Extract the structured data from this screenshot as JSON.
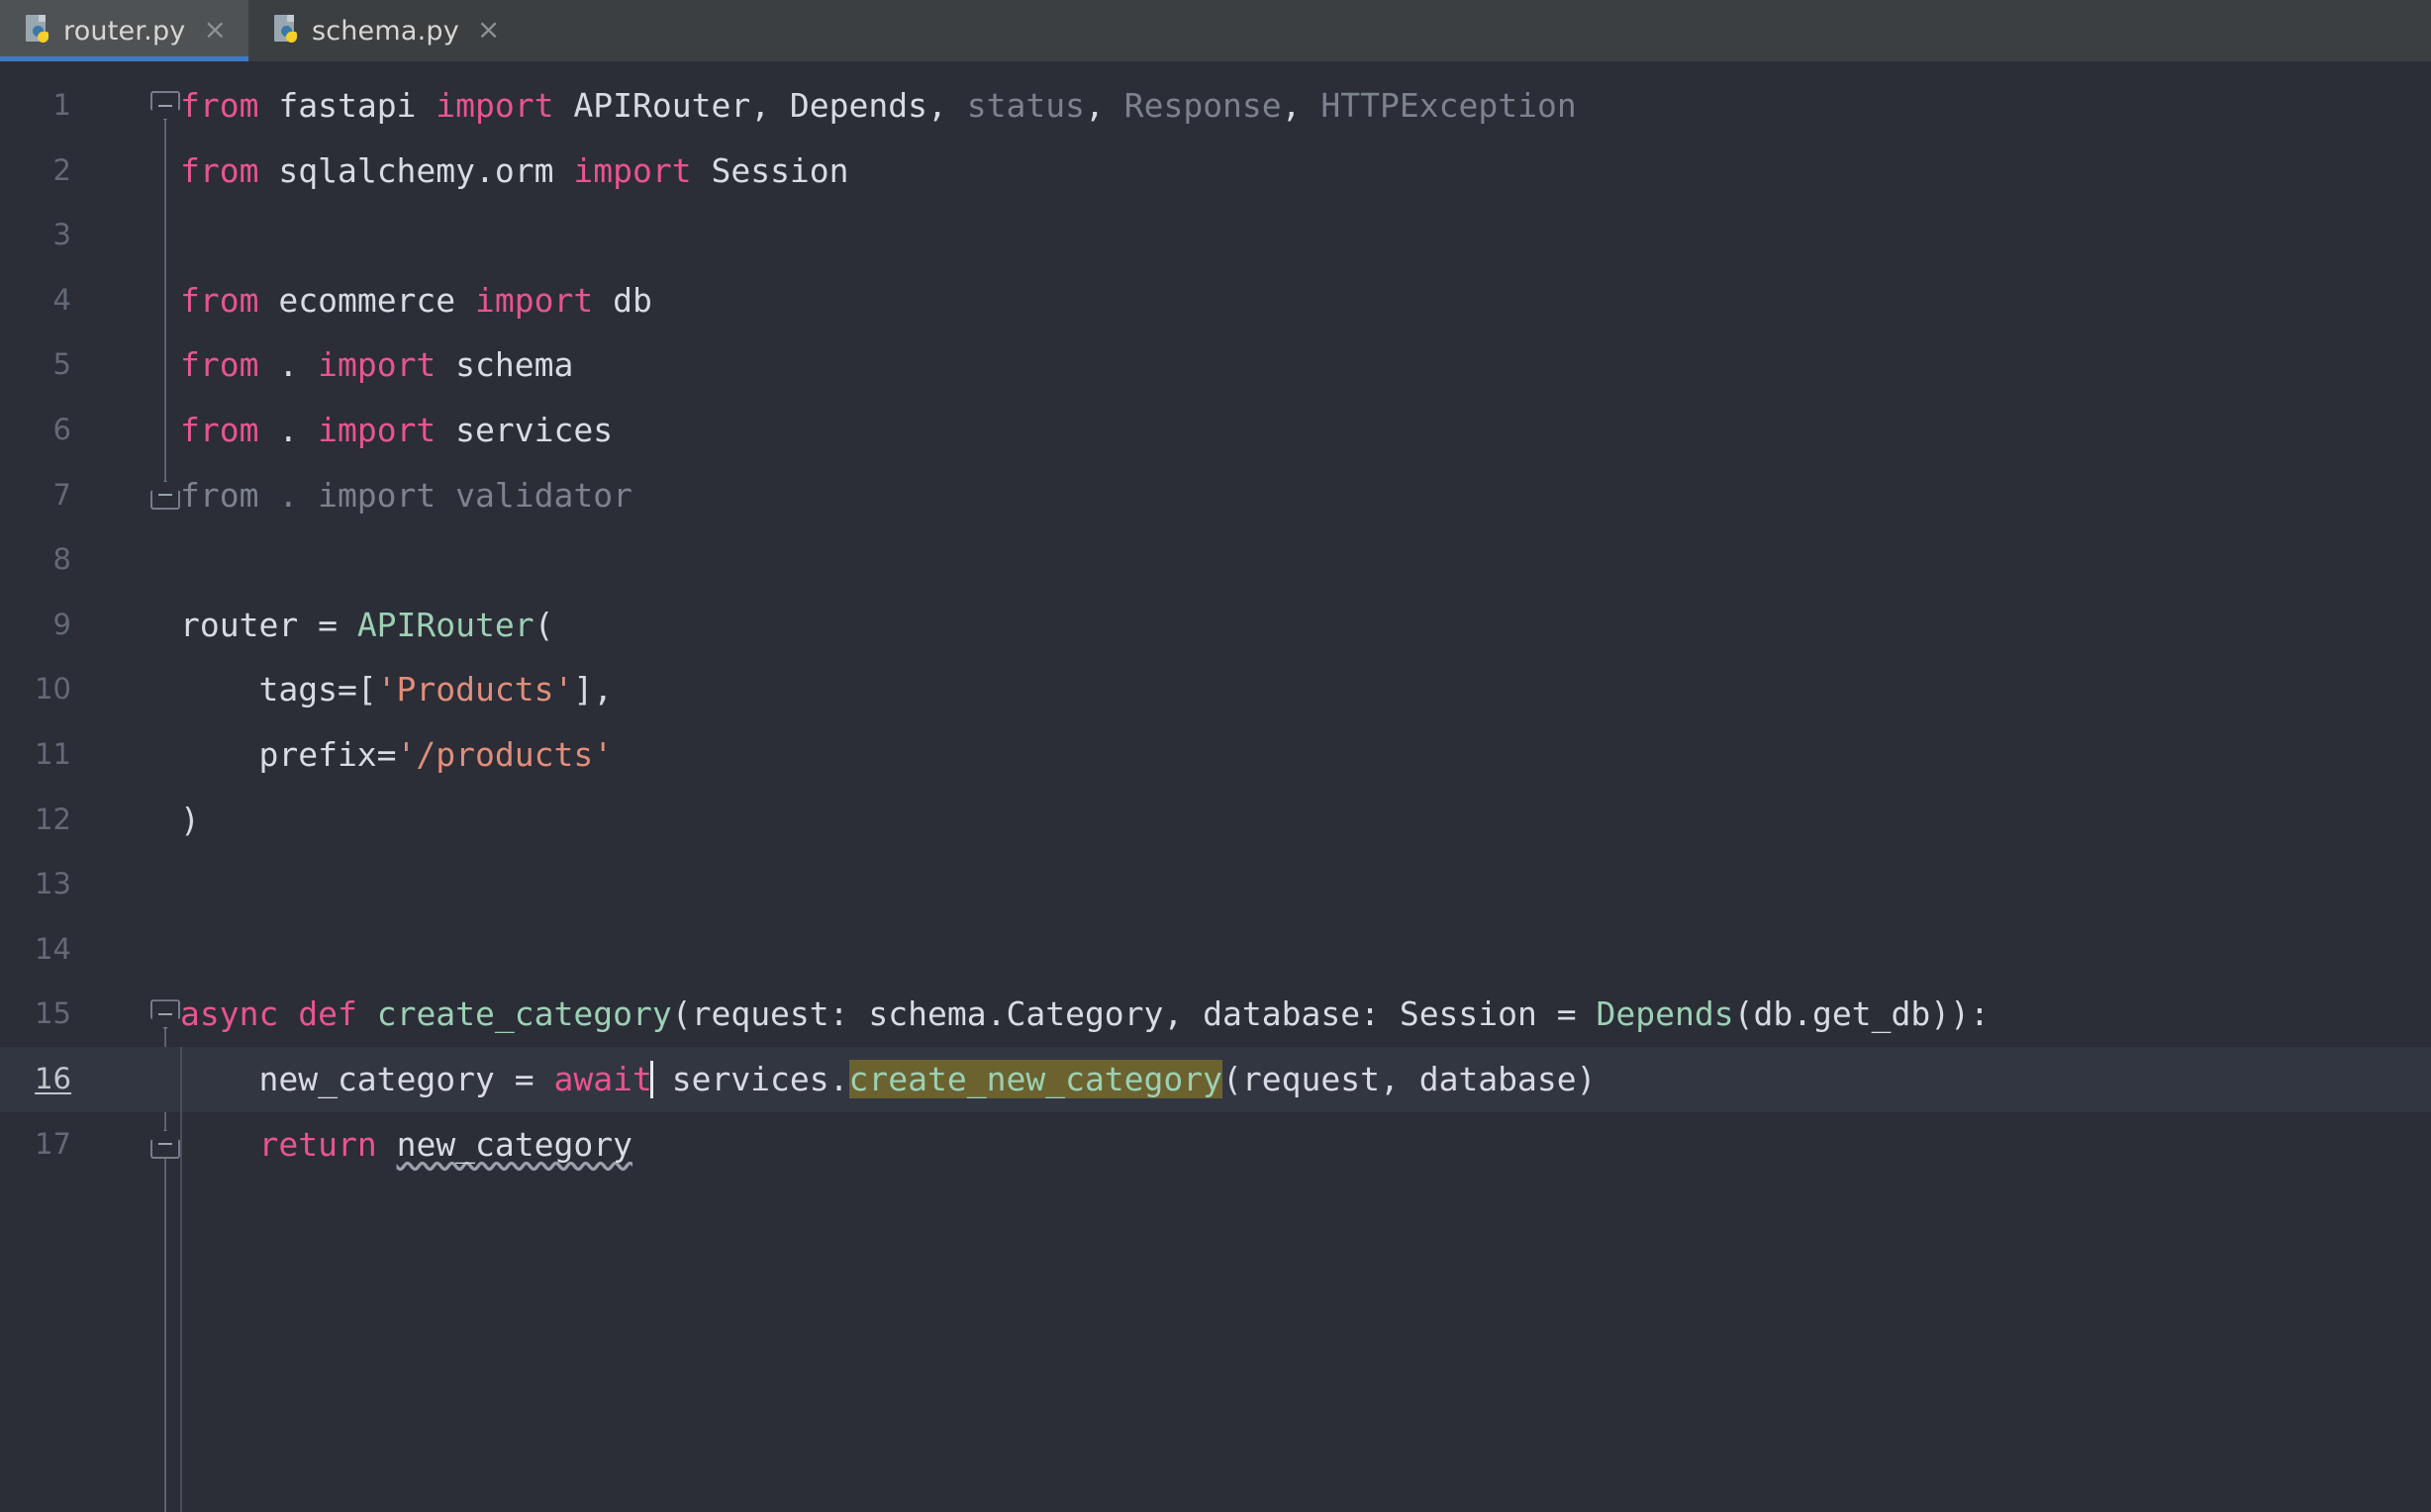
{
  "window": {
    "app": "pycharm-editor",
    "colors": {
      "editor_bg": "#2b2d37",
      "tabbar_bg": "#3c3f41",
      "active_tab_bg": "#4e5254",
      "active_tab_underline": "#3d7ac4",
      "current_line_bg": "#323641",
      "keyword": "#e8558e",
      "class_name": "#9cd0b4",
      "string": "#e08e79",
      "unused_grey": "#7c828e",
      "usage_highlight": "#6b6230",
      "line_number": "#636a75"
    }
  },
  "tabbar": {
    "tabs": [
      {
        "label": "router.py",
        "icon": "python-file-icon",
        "close_icon": "×",
        "active": true
      },
      {
        "label": "schema.py",
        "icon": "python-file-icon",
        "close_icon": "×",
        "active": false
      }
    ]
  },
  "editor": {
    "file": "router.py",
    "language": "python",
    "current_line": 16,
    "caret": {
      "line": 16,
      "after_token": "await"
    },
    "highlighted_symbol": "create_new_category",
    "warning_symbol": "new_category",
    "line_numbers": [
      "1",
      "2",
      "3",
      "4",
      "5",
      "6",
      "7",
      "8",
      "9",
      "10",
      "11",
      "12",
      "13",
      "14",
      "15",
      "16",
      "17"
    ],
    "lines": [
      {
        "n": "1",
        "text": "from fastapi import APIRouter, Depends, status, Response, HTTPException"
      },
      {
        "n": "2",
        "text": "from sqlalchemy.orm import Session"
      },
      {
        "n": "3",
        "text": ""
      },
      {
        "n": "4",
        "text": "from ecommerce import db"
      },
      {
        "n": "5",
        "text": "from . import schema"
      },
      {
        "n": "6",
        "text": "from . import services"
      },
      {
        "n": "7",
        "text": "from . import validator"
      },
      {
        "n": "8",
        "text": ""
      },
      {
        "n": "9",
        "text": "router = APIRouter("
      },
      {
        "n": "10",
        "text": "    tags=['Products'],"
      },
      {
        "n": "11",
        "text": "    prefix='/products'"
      },
      {
        "n": "12",
        "text": ")"
      },
      {
        "n": "13",
        "text": ""
      },
      {
        "n": "14",
        "text": ""
      },
      {
        "n": "15",
        "text": "async def create_category(request: schema.Category, database: Session = Depends(db.get_db)):"
      },
      {
        "n": "16",
        "text": "    new_category = await services.create_new_category(request, database)"
      },
      {
        "n": "17",
        "text": "    return new_category"
      }
    ],
    "tokens": {
      "l1": [
        [
          "from",
          "kw"
        ],
        [
          " fastapi ",
          "plain"
        ],
        [
          "import",
          "kw"
        ],
        [
          " APIRouter, Depends, ",
          "plain"
        ],
        [
          "status",
          "dim"
        ],
        [
          ", ",
          "plain"
        ],
        [
          "Response",
          "dim"
        ],
        [
          ", ",
          "plain"
        ],
        [
          "HTTPException",
          "dim"
        ]
      ],
      "l2": [
        [
          "from",
          "kw"
        ],
        [
          " sqlalchemy.orm ",
          "plain"
        ],
        [
          "import",
          "kw"
        ],
        [
          " Session",
          "plain"
        ]
      ],
      "l4": [
        [
          "from",
          "kw"
        ],
        [
          " ecommerce ",
          "plain"
        ],
        [
          "import",
          "kw"
        ],
        [
          " db",
          "plain"
        ]
      ],
      "l5": [
        [
          "from",
          "kw"
        ],
        [
          " . ",
          "plain"
        ],
        [
          "import",
          "kw"
        ],
        [
          " schema",
          "plain"
        ]
      ],
      "l6": [
        [
          "from",
          "kw"
        ],
        [
          " . ",
          "plain"
        ],
        [
          "import",
          "kw"
        ],
        [
          " services",
          "plain"
        ]
      ],
      "l7": [
        [
          "from . import validator",
          "dim"
        ]
      ],
      "l9": [
        [
          "router = ",
          "plain"
        ],
        [
          "APIRouter",
          "cls"
        ],
        [
          "(",
          "plain"
        ]
      ],
      "l10": [
        [
          "    tags=[",
          "plain"
        ],
        [
          "'Products'",
          "str"
        ],
        [
          "],",
          "plain"
        ]
      ],
      "l11": [
        [
          "    prefix=",
          "plain"
        ],
        [
          "'/products'",
          "str"
        ]
      ],
      "l12": [
        [
          ")",
          "plain"
        ]
      ],
      "l15": [
        [
          "async",
          "kw"
        ],
        [
          " ",
          "plain"
        ],
        [
          "def",
          "kw"
        ],
        [
          " ",
          "plain"
        ],
        [
          "create_category",
          "cls"
        ],
        [
          "(request: schema.Category, database: Session = ",
          "plain"
        ],
        [
          "Depends",
          "cls"
        ],
        [
          "(db.get_db)):",
          "plain"
        ]
      ],
      "l16": [
        [
          "    new_category = ",
          "plain"
        ],
        [
          "await",
          "kw"
        ],
        [
          "|caret|",
          ""
        ],
        [
          " services.",
          "plain"
        ],
        [
          "create_new_category",
          "cls hl"
        ],
        [
          "(request, database)",
          "plain"
        ]
      ],
      "l17": [
        [
          "    ",
          "plain"
        ],
        [
          "return",
          "kw"
        ],
        [
          " ",
          "plain"
        ],
        [
          "new_category",
          "plain squiggly"
        ]
      ]
    },
    "fold_markers": [
      {
        "line": 1,
        "type": "collapse-region-start",
        "glyph": "minus-box-down-icon"
      },
      {
        "line": 7,
        "type": "collapse-region-end",
        "glyph": "minus-box-up-icon"
      },
      {
        "line": 15,
        "type": "collapse-region-start",
        "glyph": "minus-box-down-icon"
      },
      {
        "line": 17,
        "type": "collapse-region-end",
        "glyph": "minus-box-up-icon"
      }
    ]
  }
}
